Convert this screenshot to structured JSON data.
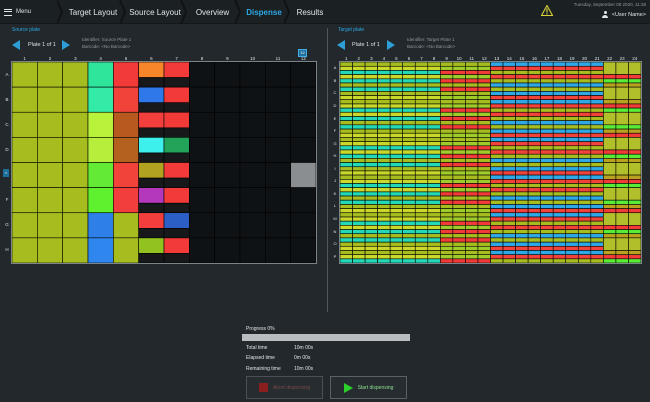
{
  "topbar": {
    "menu_label": "Menu",
    "crumbs": [
      {
        "label": "Target Layout"
      },
      {
        "label": "Source Layout"
      },
      {
        "label": "Overview"
      },
      {
        "label": "Dispense",
        "active": true
      },
      {
        "label": "Results"
      }
    ],
    "datetime": "Tuesday, September 08 2020, 11:38",
    "user_name": "<User Name>"
  },
  "source": {
    "title": "Source plate",
    "plate_label": "Plate 1 of 1",
    "identifier": "Identifier: Source Plate 1",
    "barcode": "Barcode: <No Barcode>",
    "columns": [
      "1",
      "2",
      "3",
      "4",
      "5",
      "6",
      "7",
      "8",
      "9",
      "10",
      "11",
      "12"
    ],
    "rows": [
      "A",
      "B",
      "C",
      "D",
      "E",
      "F",
      "G",
      "H"
    ],
    "badge": "12",
    "side_tab": "<"
  },
  "target": {
    "title": "Target plate",
    "plate_label": "Plate 1 of 1",
    "identifier": "Identifier: Target Plate 1",
    "barcode": "Barcode: <No Barcode>",
    "columns": [
      "1",
      "2",
      "3",
      "4",
      "5",
      "6",
      "7",
      "8",
      "9",
      "10",
      "11",
      "12",
      "13",
      "14",
      "15",
      "16",
      "17",
      "18",
      "19",
      "20",
      "21",
      "22",
      "23",
      "24"
    ],
    "rows": [
      "A",
      "B",
      "C",
      "D",
      "E",
      "F",
      "G",
      "H",
      "I",
      "J",
      "K",
      "L",
      "M",
      "N",
      "O",
      "P"
    ]
  },
  "progress": {
    "label": "Progress 0%",
    "value": 0,
    "total_label": "Total time",
    "total_value": "10m 00s",
    "elapsed_label": "Elapsed time",
    "elapsed_value": "0m 00s",
    "remaining_label": "Remaining time",
    "remaining_value": "10m 00s"
  },
  "buttons": {
    "abort_label": "Abort dispensing",
    "start_label": "Start dispensing"
  },
  "colors": {
    "accent": "#2aa8e6",
    "olive": "#a7bd1f",
    "empty_well": "#0f1214",
    "abort_icon": "#8b1e1e",
    "start_icon": "#2bd02b"
  }
}
